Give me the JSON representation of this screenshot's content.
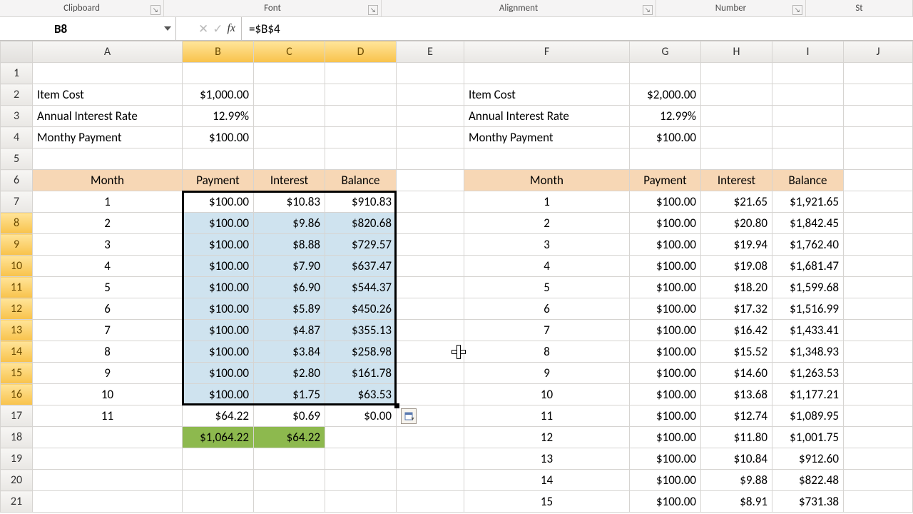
{
  "ribbon_groups": {
    "clipboard": "Clipboard",
    "font": "Font",
    "alignment": "Alignment",
    "number": "Number",
    "styles": "St"
  },
  "namebox": "B8",
  "formula": "=$B$4",
  "columns": [
    "A",
    "B",
    "C",
    "D",
    "E",
    "F",
    "G",
    "H",
    "I",
    "J"
  ],
  "row_numbers": [
    "1",
    "2",
    "3",
    "4",
    "5",
    "6",
    "7",
    "8",
    "9",
    "10",
    "11",
    "12",
    "13",
    "14",
    "15",
    "16",
    "17",
    "18",
    "19",
    "20",
    "21"
  ],
  "left": {
    "item_cost_label": "Item Cost",
    "item_cost_value": "$1,000.00",
    "rate_label": "Annual Interest Rate",
    "rate_value": "12.99%",
    "payment_label": "Monthy Payment",
    "payment_value": "$100.00",
    "headers": {
      "month": "Month",
      "payment": "Payment",
      "interest": "Interest",
      "balance": "Balance"
    },
    "rows": [
      {
        "month": "1",
        "payment": "$100.00",
        "interest": "$10.83",
        "balance": "$910.83"
      },
      {
        "month": "2",
        "payment": "$100.00",
        "interest": "$9.86",
        "balance": "$820.68"
      },
      {
        "month": "3",
        "payment": "$100.00",
        "interest": "$8.88",
        "balance": "$729.57"
      },
      {
        "month": "4",
        "payment": "$100.00",
        "interest": "$7.90",
        "balance": "$637.47"
      },
      {
        "month": "5",
        "payment": "$100.00",
        "interest": "$6.90",
        "balance": "$544.37"
      },
      {
        "month": "6",
        "payment": "$100.00",
        "interest": "$5.89",
        "balance": "$450.26"
      },
      {
        "month": "7",
        "payment": "$100.00",
        "interest": "$4.87",
        "balance": "$355.13"
      },
      {
        "month": "8",
        "payment": "$100.00",
        "interest": "$3.84",
        "balance": "$258.98"
      },
      {
        "month": "9",
        "payment": "$100.00",
        "interest": "$2.80",
        "balance": "$161.78"
      },
      {
        "month": "10",
        "payment": "$100.00",
        "interest": "$1.75",
        "balance": "$63.53"
      },
      {
        "month": "11",
        "payment": "$64.22",
        "interest": "$0.69",
        "balance": "$0.00"
      }
    ],
    "totals": {
      "payment": "$1,064.22",
      "interest": "$64.22"
    }
  },
  "right": {
    "item_cost_label": "Item Cost",
    "item_cost_value": "$2,000.00",
    "rate_label": "Annual Interest Rate",
    "rate_value": "12.99%",
    "payment_label": "Monthy Payment",
    "payment_value": "$100.00",
    "headers": {
      "month": "Month",
      "payment": "Payment",
      "interest": "Interest",
      "balance": "Balance"
    },
    "rows": [
      {
        "month": "1",
        "payment": "$100.00",
        "interest": "$21.65",
        "balance": "$1,921.65"
      },
      {
        "month": "2",
        "payment": "$100.00",
        "interest": "$20.80",
        "balance": "$1,842.45"
      },
      {
        "month": "3",
        "payment": "$100.00",
        "interest": "$19.94",
        "balance": "$1,762.40"
      },
      {
        "month": "4",
        "payment": "$100.00",
        "interest": "$19.08",
        "balance": "$1,681.47"
      },
      {
        "month": "5",
        "payment": "$100.00",
        "interest": "$18.20",
        "balance": "$1,599.68"
      },
      {
        "month": "6",
        "payment": "$100.00",
        "interest": "$17.32",
        "balance": "$1,516.99"
      },
      {
        "month": "7",
        "payment": "$100.00",
        "interest": "$16.42",
        "balance": "$1,433.41"
      },
      {
        "month": "8",
        "payment": "$100.00",
        "interest": "$15.52",
        "balance": "$1,348.93"
      },
      {
        "month": "9",
        "payment": "$100.00",
        "interest": "$14.60",
        "balance": "$1,263.53"
      },
      {
        "month": "10",
        "payment": "$100.00",
        "interest": "$13.68",
        "balance": "$1,177.21"
      },
      {
        "month": "11",
        "payment": "$100.00",
        "interest": "$12.74",
        "balance": "$1,089.95"
      },
      {
        "month": "12",
        "payment": "$100.00",
        "interest": "$11.80",
        "balance": "$1,001.75"
      },
      {
        "month": "13",
        "payment": "$100.00",
        "interest": "$10.84",
        "balance": "$912.60"
      },
      {
        "month": "14",
        "payment": "$100.00",
        "interest": "$9.88",
        "balance": "$822.48"
      },
      {
        "month": "15",
        "payment": "$100.00",
        "interest": "$8.91",
        "balance": "$731.38"
      }
    ]
  },
  "selection": {
    "active_cell": "B8",
    "range": "B7:D16",
    "selected_cols": [
      "B",
      "C",
      "D"
    ],
    "selected_rows": [
      "8",
      "9",
      "10",
      "11",
      "12",
      "13",
      "14",
      "15",
      "16"
    ]
  }
}
